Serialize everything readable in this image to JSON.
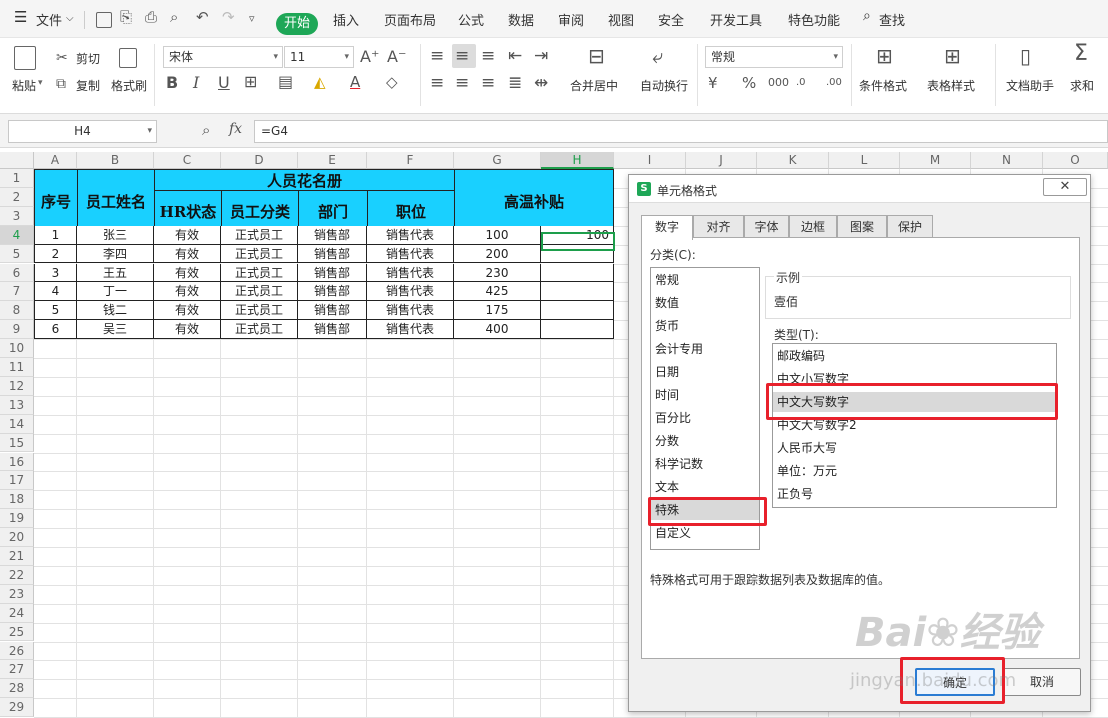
{
  "menu": {
    "file": "文件",
    "tabs": [
      "开始",
      "插入",
      "页面布局",
      "公式",
      "数据",
      "审阅",
      "视图",
      "安全",
      "开发工具",
      "特色功能"
    ],
    "search": "查找",
    "active_tab": "开始"
  },
  "ribbon": {
    "paste": "粘贴",
    "cut": "剪切",
    "copy": "复制",
    "format_painter": "格式刷",
    "font_name": "宋体",
    "font_size": "11",
    "merge_center": "合并居中",
    "wrap_text": "自动换行",
    "number_format": "常规",
    "cond_format": "条件格式",
    "table_style": "表格样式",
    "doc_assistant": "文档助手",
    "sum": "求和"
  },
  "formula_bar": {
    "name_box": "H4",
    "fx": "fx",
    "formula": "=G4"
  },
  "grid": {
    "columns": [
      "A",
      "B",
      "C",
      "D",
      "E",
      "F",
      "G",
      "H",
      "I",
      "J",
      "K",
      "L",
      "M",
      "N",
      "O"
    ],
    "rows": [
      "1",
      "2",
      "3",
      "4",
      "5",
      "6",
      "7",
      "8",
      "9",
      "10",
      "11",
      "12",
      "13",
      "14",
      "15",
      "16",
      "17",
      "18",
      "19",
      "20",
      "21",
      "22",
      "23",
      "24",
      "25",
      "26",
      "27",
      "28",
      "29"
    ],
    "title": "人员花名册",
    "headers": {
      "seq": "序号",
      "name": "员工姓名",
      "hr": "HR状态",
      "type": "员工分类",
      "dept": "部门",
      "pos": "职位",
      "subsidy": "高温补贴"
    },
    "data": [
      [
        "1",
        "张三",
        "有效",
        "正式员工",
        "销售部",
        "销售代表",
        "100",
        "100"
      ],
      [
        "2",
        "李四",
        "有效",
        "正式员工",
        "销售部",
        "销售代表",
        "200",
        ""
      ],
      [
        "3",
        "王五",
        "有效",
        "正式员工",
        "销售部",
        "销售代表",
        "230",
        ""
      ],
      [
        "4",
        "丁一",
        "有效",
        "正式员工",
        "销售部",
        "销售代表",
        "425",
        ""
      ],
      [
        "5",
        "钱二",
        "有效",
        "正式员工",
        "销售部",
        "销售代表",
        "175",
        ""
      ],
      [
        "6",
        "吴三",
        "有效",
        "正式员工",
        "销售部",
        "销售代表",
        "400",
        ""
      ]
    ]
  },
  "dialog": {
    "title": "单元格格式",
    "tabs": [
      "数字",
      "对齐",
      "字体",
      "边框",
      "图案",
      "保护"
    ],
    "category_label": "分类(C):",
    "categories": [
      "常规",
      "数值",
      "货币",
      "会计专用",
      "日期",
      "时间",
      "百分比",
      "分数",
      "科学记数",
      "文本",
      "特殊",
      "自定义"
    ],
    "selected_category": "特殊",
    "sample_label": "示例",
    "sample_value": "壹佰",
    "type_label": "类型(T):",
    "types": [
      "邮政编码",
      "中文小写数字",
      "中文大写数字",
      "中文大写数字2",
      "人民币大写",
      "单位：万元",
      "正负号"
    ],
    "selected_type": "中文大写数字",
    "description": "特殊格式可用于跟踪数据列表及数据库的值。",
    "ok": "确定",
    "cancel": "取消"
  },
  "watermark": {
    "brand": "Bai",
    "brand_cn": "经验",
    "url": "jingyan.baidu.com"
  }
}
